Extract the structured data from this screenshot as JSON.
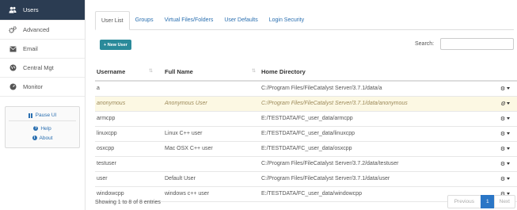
{
  "sidebar": {
    "items": [
      {
        "label": "Users",
        "icon": "users-icon"
      },
      {
        "label": "Advanced",
        "icon": "gears-icon"
      },
      {
        "label": "Email",
        "icon": "envelope-icon"
      },
      {
        "label": "Central Mgt",
        "icon": "globe-icon"
      },
      {
        "label": "Monitor",
        "icon": "dashboard-icon"
      }
    ],
    "pause_label": "Pause UI",
    "help_label": "Help",
    "about_label": "About"
  },
  "tabs": [
    "User List",
    "Groups",
    "Virtual Files/Folders",
    "User Defaults",
    "Login Security"
  ],
  "toolbar": {
    "new_user_label": "+ New User",
    "search_label": "Search:",
    "search_value": ""
  },
  "table": {
    "headers": {
      "username": "Username",
      "full_name": "Full Name",
      "home": "Home Directory"
    },
    "rows": [
      {
        "username": "a",
        "full_name": "",
        "home": "C:/Program Files/FileCatalyst Server/3.7.1/data/a"
      },
      {
        "username": "anonymous",
        "full_name": "Anonymous User",
        "home": "C:/Program Files/FileCatalyst Server/3.7.1/data/anonymous"
      },
      {
        "username": "armcpp",
        "full_name": "",
        "home": "E:/TESTDATA/FC_user_data/armcpp"
      },
      {
        "username": "linuxcpp",
        "full_name": "Linux C++ user",
        "home": "E:/TESTDATA/FC_user_data/linuxcpp"
      },
      {
        "username": "osxcpp",
        "full_name": "Mac OSX C++ user",
        "home": "E:/TESTDATA/FC_user_data/osxcpp"
      },
      {
        "username": "testuser",
        "full_name": "",
        "home": "C:/Program Files/FileCatalyst Server/3.7.2/data/testuser"
      },
      {
        "username": "user",
        "full_name": "Default User",
        "home": "C:/Program Files/FileCatalyst Server/3.7.1/data/user"
      },
      {
        "username": "windowcpp",
        "full_name": "windows c++ user",
        "home": "E:/TESTDATA/FC_user_data/windowcpp"
      }
    ]
  },
  "footer": {
    "info": "Showing 1 to 8 of 8 entries",
    "previous": "Previous",
    "page": "1",
    "next": "Next"
  },
  "colors": {
    "sidebar_active": "#2b3c52",
    "accent": "#2a76c6",
    "new_button": "#2a8a9a",
    "highlight_row": "#fcf8e3"
  }
}
